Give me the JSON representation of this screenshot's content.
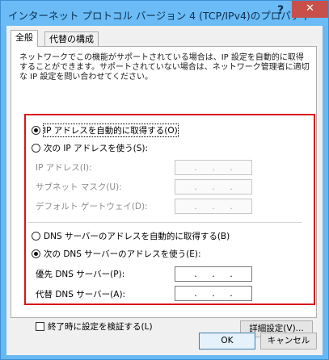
{
  "window": {
    "title": "インターネット プロトコル バージョン 4 (TCP/IPv4)のプロパティ",
    "help_label": "?",
    "close_label": "✕"
  },
  "tabs": [
    {
      "label": "全般"
    },
    {
      "label": "代替の構成"
    }
  ],
  "description": "ネットワークでこの機能がサポートされている場合は、IP 設定を自動的に取得することができます。サポートされていない場合は、ネットワーク管理者に適切な IP 設定を問い合わせてください。",
  "ip_section": {
    "auto_label": "IP アドレスを自動的に取得する(O)",
    "manual_label": "次の IP アドレスを使う(S):",
    "ip_address_label": "IP アドレス(I):",
    "subnet_label": "サブネット マスク(U):",
    "gateway_label": "デフォルト ゲートウェイ(D):",
    "selected": "auto"
  },
  "dns_section": {
    "auto_label": "DNS サーバーのアドレスを自動的に取得する(B)",
    "manual_label": "次の DNS サーバーのアドレスを使う(E):",
    "preferred_label": "優先 DNS サーバー(P):",
    "alternate_label": "代替 DNS サーバー(A):",
    "selected": "manual"
  },
  "ip_dots": ".",
  "validate_label": "終了時に設定を検証する(L)",
  "advanced_label": "詳細設定(V)...",
  "ok_label": "OK",
  "cancel_label": "キャンセル",
  "colors": {
    "highlight_border": "#d8131b",
    "title_bar": "#6bbcf6",
    "close_button": "#c7504a"
  }
}
